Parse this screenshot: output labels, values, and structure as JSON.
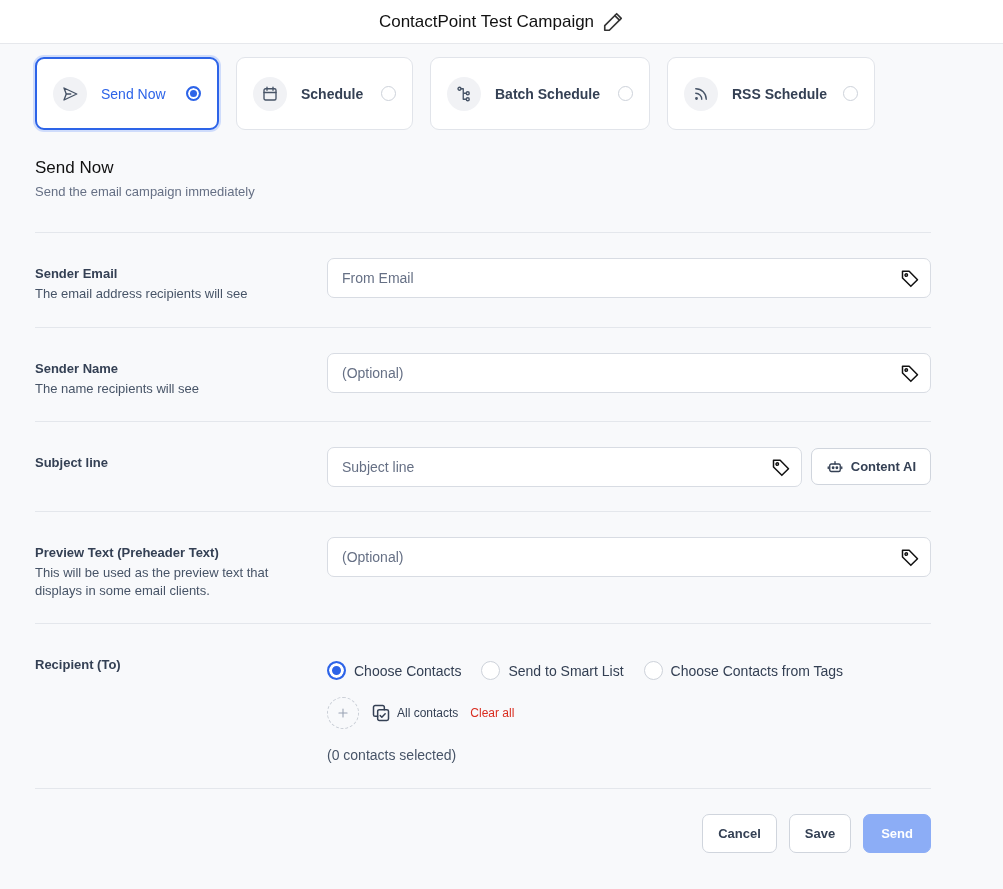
{
  "header": {
    "title": "ContactPoint Test Campaign"
  },
  "schedule_options": [
    {
      "label": "Send Now",
      "kind": "send",
      "selected": true
    },
    {
      "label": "Schedule",
      "kind": "calendar",
      "selected": false
    },
    {
      "label": "Batch Schedule",
      "kind": "batch",
      "selected": false
    },
    {
      "label": "RSS Schedule",
      "kind": "rss",
      "selected": false
    }
  ],
  "section": {
    "title": "Send Now",
    "subtitle": "Send the email campaign immediately"
  },
  "rows": [
    {
      "kind": "field",
      "label": "Sender Email",
      "description": "The email address recipients will see",
      "placeholder": "From Email"
    },
    {
      "kind": "field",
      "label": "Sender Name",
      "description": "The name recipients will see",
      "placeholder": "(Optional)"
    },
    {
      "kind": "field",
      "label": "Subject line",
      "placeholder": "Subject line",
      "action_button": "Content AI"
    },
    {
      "kind": "field",
      "label": "Preview Text (Preheader Text)",
      "description": "This will be used as the preview text that displays in some email clients.",
      "placeholder": "(Optional)"
    },
    {
      "kind": "recipient",
      "label": "Recipient (To)",
      "options": [
        {
          "label": "Choose Contacts",
          "selected": true
        },
        {
          "label": "Send to Smart List",
          "selected": false
        },
        {
          "label": "Choose Contacts from Tags",
          "selected": false
        }
      ],
      "filter_label": "All contacts",
      "clear_label": "Clear all",
      "count": "(0 contacts selected)"
    }
  ],
  "buttons": [
    {
      "label": "Cancel",
      "kind": "secondary",
      "disabled": false
    },
    {
      "label": "Save",
      "kind": "secondary",
      "disabled": false
    },
    {
      "label": "Send",
      "kind": "primary",
      "disabled": true
    }
  ]
}
